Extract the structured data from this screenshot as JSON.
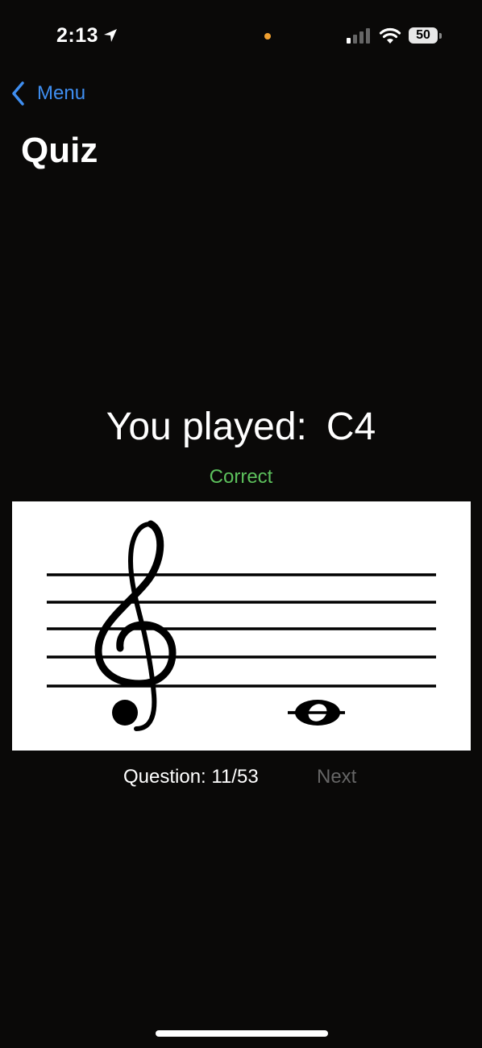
{
  "status_bar": {
    "time": "2:13",
    "battery": "50",
    "icons": [
      "location-arrow-icon",
      "recording-dot-icon",
      "cellular-signal-icon",
      "wifi-icon",
      "battery-icon"
    ],
    "dot_color": "#f0a030"
  },
  "nav": {
    "back_label": "Menu",
    "title": "Quiz"
  },
  "quiz": {
    "played_label": "You played:",
    "played_note": "C4",
    "result": "Correct",
    "result_color": "#5cc05c",
    "staff": {
      "clef": "treble",
      "note": "C4",
      "note_value": "whole",
      "ledger_line": true
    },
    "question_label": "Question: 11/53",
    "next_label": "Next"
  },
  "colors": {
    "background": "#0a0908",
    "accent": "#3f8ef0",
    "disabled": "#666666"
  }
}
